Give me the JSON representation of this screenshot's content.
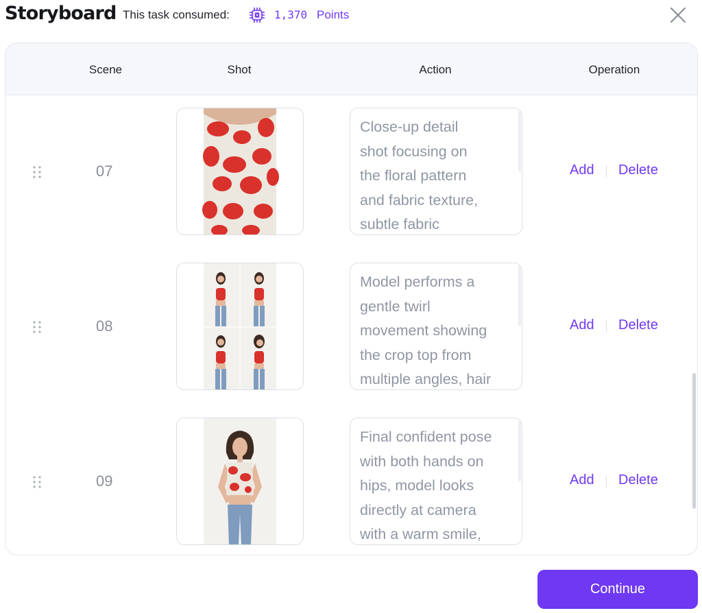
{
  "header": {
    "title": "Storyboard",
    "consumed_label": "This task consumed:",
    "points_value": "1,370",
    "points_label": "Points",
    "points_icon": "chip-icon",
    "close_icon": "close-icon"
  },
  "table": {
    "columns": [
      "Scene",
      "Shot",
      "Action",
      "Operation"
    ],
    "rows": [
      {
        "scene": "07",
        "shot_image": "floral crop top fabric close-up",
        "action_lines": [
          "Close-up detail",
          "shot focusing on",
          "the floral pattern",
          "and fabric texture,",
          "subtle fabric"
        ],
        "add_label": "Add",
        "delete_label": "Delete"
      },
      {
        "scene": "08",
        "shot_image": "model twirl grid of four poses",
        "action_lines": [
          "Model performs a",
          "gentle twirl",
          "movement showing",
          "the crop top from",
          "multiple angles, hair"
        ],
        "add_label": "Add",
        "delete_label": "Delete"
      },
      {
        "scene": "09",
        "shot_image": "model hands on hips pose",
        "action_lines": [
          "Final confident pose",
          "with both hands on",
          "hips, model looks",
          "directly at camera",
          "with a warm smile,"
        ],
        "add_label": "Add",
        "delete_label": "Delete"
      }
    ]
  },
  "footer": {
    "continue_label": "Continue"
  },
  "colors": {
    "accent": "#6f38f2",
    "muted_text": "#8f96a3",
    "header_bg": "#f6f7fa",
    "floral_red": "#d9312b",
    "fabric_bg": "#ece7df"
  }
}
